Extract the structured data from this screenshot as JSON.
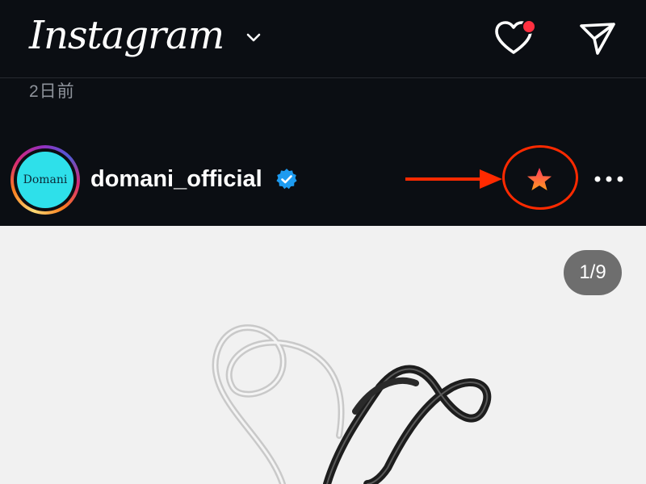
{
  "app": {
    "logo_text": "Instagram"
  },
  "topbar": {
    "icons": [
      "chevron-down-icon",
      "heart-icon",
      "send-icon"
    ],
    "notification_dot_color": "#ff3040"
  },
  "feed": {
    "timestamp": "2日前"
  },
  "post": {
    "username": "domani_official",
    "verified": true,
    "avatar_text": "Domani",
    "favorite_icon": "star-icon",
    "more_icon": "more-horizontal-icon",
    "image_counter": "1/9"
  },
  "annotation": {
    "color": "#ff2a00",
    "highlight": "favorite star icon"
  },
  "colors": {
    "background": "#0b0e13",
    "verified_blue": "#1d9bf0",
    "annotation_red": "#ff2a00",
    "photo_background": "#f1f1f1"
  }
}
